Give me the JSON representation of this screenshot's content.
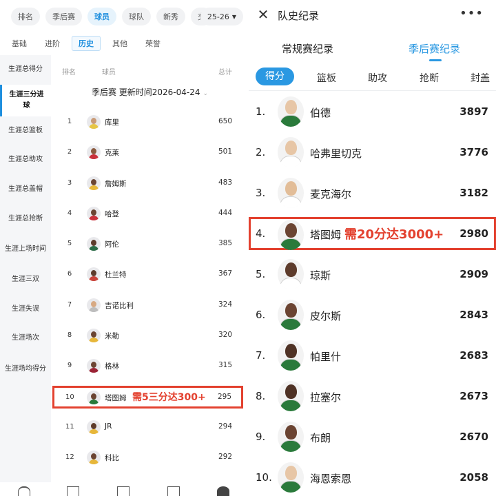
{
  "left": {
    "top_tabs": [
      "排名",
      "季后赛",
      "球员",
      "球队",
      "新秀",
      "交"
    ],
    "season": "25-26",
    "sub_tabs": [
      "基础",
      "进阶",
      "历史",
      "其他",
      "荣誉"
    ],
    "categories": [
      "生涯总得分",
      "生涯三分进球",
      "生涯总篮板",
      "生涯总助攻",
      "生涯总盖帽",
      "生涯总抢断",
      "生涯上场时间",
      "生涯三双",
      "生涯失误",
      "生涯场次",
      "生涯场均得分"
    ],
    "headers": {
      "rank": "排名",
      "player": "球员",
      "total": "总计"
    },
    "filter": "季后赛 更新时间2026-04-24",
    "rows": [
      {
        "rank": "1",
        "name": "库里",
        "value": "650",
        "skin": "#c99a76",
        "jersey": "#e6c546"
      },
      {
        "rank": "2",
        "name": "克莱",
        "value": "501",
        "skin": "#8a5a3e",
        "jersey": "#c9303a"
      },
      {
        "rank": "3",
        "name": "詹姆斯",
        "value": "483",
        "skin": "#6b4432",
        "jersey": "#e7b73a"
      },
      {
        "rank": "4",
        "name": "哈登",
        "value": "444",
        "skin": "#6b4432",
        "jersey": "#c9303a"
      },
      {
        "rank": "5",
        "name": "阿伦",
        "value": "385",
        "skin": "#5d3b2b",
        "jersey": "#2a6b46"
      },
      {
        "rank": "6",
        "name": "杜兰特",
        "value": "367",
        "skin": "#5d3b2b",
        "jersey": "#c9433a"
      },
      {
        "rank": "7",
        "name": "吉诺比利",
        "value": "324",
        "skin": "#d7a983",
        "jersey": "#bdbdbd"
      },
      {
        "rank": "8",
        "name": "米勒",
        "value": "320",
        "skin": "#6b4432",
        "jersey": "#e7b73a"
      },
      {
        "rank": "9",
        "name": "格林",
        "value": "315",
        "skin": "#6b4432",
        "jersey": "#9b2335"
      },
      {
        "rank": "10",
        "name": "塔图姆",
        "value": "295",
        "skin": "#6b4432",
        "jersey": "#2a7a3b",
        "note": "需5三分达300+"
      },
      {
        "rank": "11",
        "name": "JR",
        "value": "294",
        "skin": "#5d3b2b",
        "jersey": "#e7b73a"
      },
      {
        "rank": "12",
        "name": "科比",
        "value": "292",
        "skin": "#6b4432",
        "jersey": "#e7b73a"
      }
    ]
  },
  "right": {
    "title": "队史纪录",
    "more": "•••",
    "close": "✕",
    "segments": [
      "常规赛纪录",
      "季后赛纪录"
    ],
    "stat_tabs": [
      "得分",
      "篮板",
      "助攻",
      "抢断",
      "封盖"
    ],
    "rows": [
      {
        "rank": "1.",
        "name": "伯德",
        "value": "3897",
        "skin": "#e7c6a6",
        "jersey": "#2a7a3b"
      },
      {
        "rank": "2.",
        "name": "哈弗里切克",
        "value": "3776",
        "skin": "#e7c6a6",
        "jersey": "#ffffff"
      },
      {
        "rank": "3.",
        "name": "麦克海尔",
        "value": "3182",
        "skin": "#e2bd98",
        "jersey": "#ffffff"
      },
      {
        "rank": "4.",
        "name": "塔图姆",
        "value": "2980",
        "skin": "#6b4432",
        "jersey": "#2a7a3b",
        "note": "需20分达3000+"
      },
      {
        "rank": "5.",
        "name": "琼斯",
        "value": "2909",
        "skin": "#5d3b2b",
        "jersey": "#ffffff"
      },
      {
        "rank": "6.",
        "name": "皮尔斯",
        "value": "2843",
        "skin": "#6b4432",
        "jersey": "#2a7a3b"
      },
      {
        "rank": "7.",
        "name": "帕里什",
        "value": "2683",
        "skin": "#4f3225",
        "jersey": "#2a7a3b"
      },
      {
        "rank": "8.",
        "name": "拉塞尔",
        "value": "2673",
        "skin": "#4f3225",
        "jersey": "#2a7a3b"
      },
      {
        "rank": "9.",
        "name": "布朗",
        "value": "2670",
        "skin": "#6b4432",
        "jersey": "#2a7a3b"
      },
      {
        "rank": "10.",
        "name": "海恩索恩",
        "value": "2058",
        "skin": "#e7c6a6",
        "jersey": "#2a7a3b"
      }
    ]
  },
  "colors": {
    "accent": "#2a98e2",
    "highlight": "#e3412f"
  }
}
